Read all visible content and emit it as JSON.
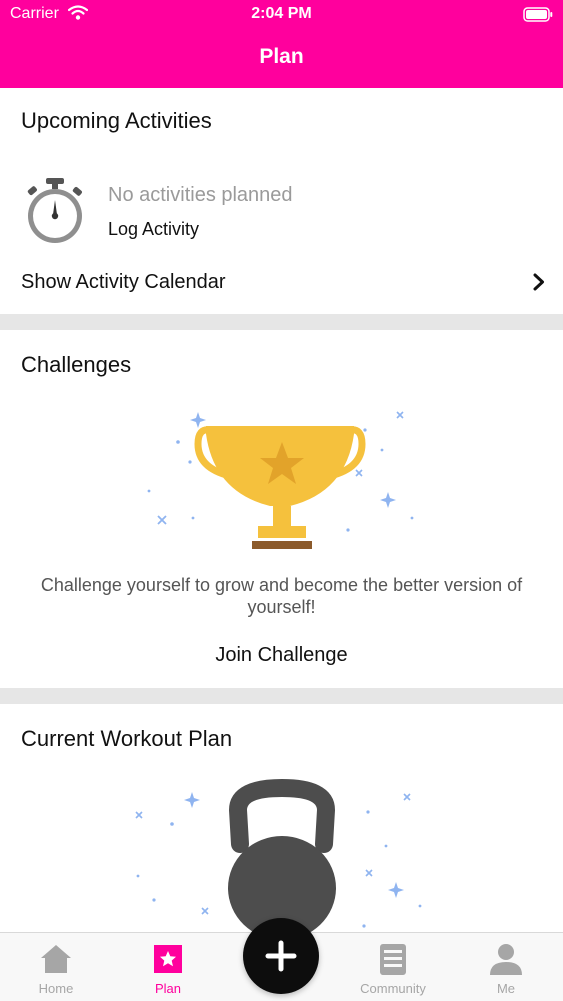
{
  "status_bar": {
    "carrier": "Carrier",
    "time": "2:04 PM"
  },
  "nav": {
    "title": "Plan"
  },
  "upcoming": {
    "title": "Upcoming Activities",
    "empty_text": "No activities planned",
    "log_label": "Log Activity",
    "calendar_label": "Show Activity Calendar"
  },
  "challenges": {
    "title": "Challenges",
    "description": "Challenge yourself to grow and become the better version of yourself!",
    "join_label": "Join Challenge"
  },
  "workout": {
    "title": "Current Workout Plan"
  },
  "tabs": [
    {
      "label": "Home",
      "icon": "home-icon"
    },
    {
      "label": "Plan",
      "icon": "plan-star-icon"
    },
    {
      "label": "Community",
      "icon": "community-icon"
    },
    {
      "label": "Me",
      "icon": "person-icon"
    }
  ],
  "add_button": {
    "icon": "plus-icon"
  },
  "colors": {
    "brand": "#ff009d",
    "tab_inactive": "#a6a6a6",
    "trophy": "#f5c13d",
    "kettlebell": "#4d4d4d"
  }
}
